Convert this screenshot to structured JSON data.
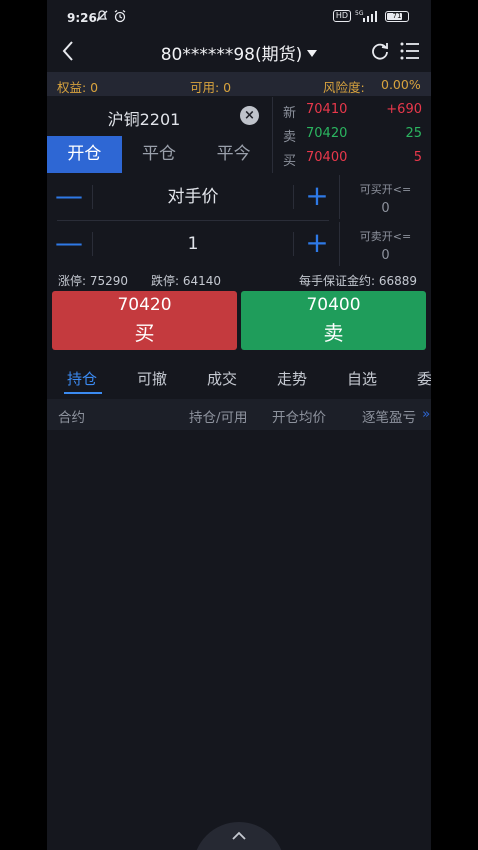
{
  "status_bar": {
    "time": "9:26",
    "network": "5G",
    "battery": "71"
  },
  "header": {
    "account_title": "80******98(期货)"
  },
  "account": {
    "equity_label": "权益: 0",
    "available_label": "可用: 0",
    "risk_label": "风险度:",
    "risk_value": "0.00%"
  },
  "order": {
    "symbol": "沪铜2201",
    "mode_tabs": [
      {
        "label": "开仓",
        "active": true
      },
      {
        "label": "平仓",
        "active": false
      },
      {
        "label": "平今",
        "active": false
      }
    ],
    "price_field": "对手价",
    "qty_field": "1",
    "can_buy_label": "可买开<=",
    "can_buy_value": "0",
    "can_sell_label": "可卖开<=",
    "can_sell_value": "0",
    "minus_glyph": "—",
    "plus_glyph": "+"
  },
  "quotes": [
    {
      "label": "新",
      "price": "70410",
      "change": "+690"
    },
    {
      "label": "卖",
      "price": "70420",
      "change": "25"
    },
    {
      "label": "买",
      "price": "70400",
      "change": "5"
    }
  ],
  "limits": {
    "limit_up": "涨停: 75290",
    "limit_down": "跌停: 64140",
    "margin": "每手保证金约: 66889"
  },
  "actions": {
    "buy_price": "70420",
    "buy_label": "买",
    "sell_price": "70400",
    "sell_label": "卖"
  },
  "bottom_tabs": [
    "持仓",
    "可撤",
    "成交",
    "走势",
    "自选",
    "委"
  ],
  "positions_table": {
    "columns": [
      "合约",
      "持仓/可用",
      "开仓均价",
      "逐笔盈亏"
    ],
    "more_glyph": "»"
  },
  "colors": {
    "accent": "#2e67d4",
    "up": "#e8384b",
    "down": "#2bb560",
    "warning": "#d8a33e"
  },
  "icons": [
    "back-arrow-icon",
    "caret-down-icon",
    "refresh-icon",
    "menu-list-icon",
    "clear-icon",
    "chevron-up-icon"
  ]
}
